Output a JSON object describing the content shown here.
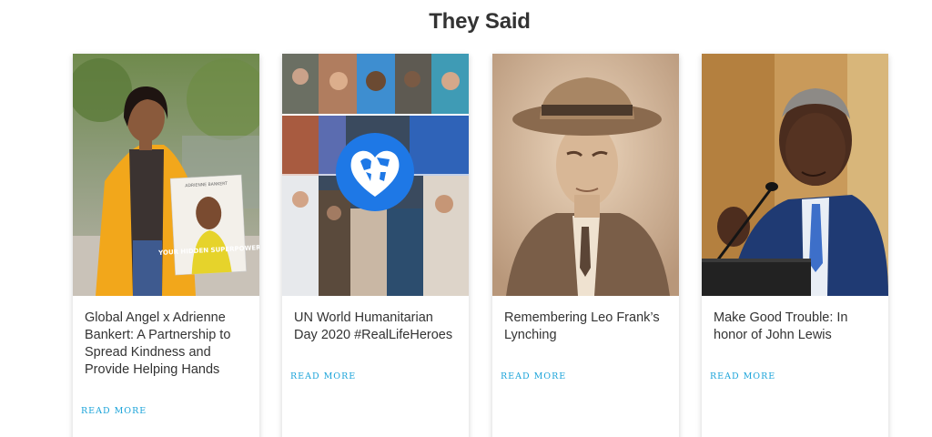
{
  "section": {
    "title": "They Said"
  },
  "cards": [
    {
      "title": "Global Angel x Adrienne Bankert: A Partnership to Spread Kindness and Provide Helping Hands",
      "read_more": "READ MORE",
      "image": {
        "book_author": "ADRIENNE BANKERT",
        "book_title": "YOUR HIDDEN SUPERPOWER"
      }
    },
    {
      "title": "UN World Humanitarian Day 2020 #RealLifeHeroes",
      "read_more": "READ MORE"
    },
    {
      "title": "Remembering Leo Frank’s Lynching",
      "read_more": "READ MORE"
    },
    {
      "title": "Make Good Trouble: In honor of John Lewis",
      "read_more": "READ MORE"
    }
  ],
  "colors": {
    "accent": "#1aa3d9",
    "title_text": "#333333",
    "heart_blue": "#1e78e6"
  }
}
